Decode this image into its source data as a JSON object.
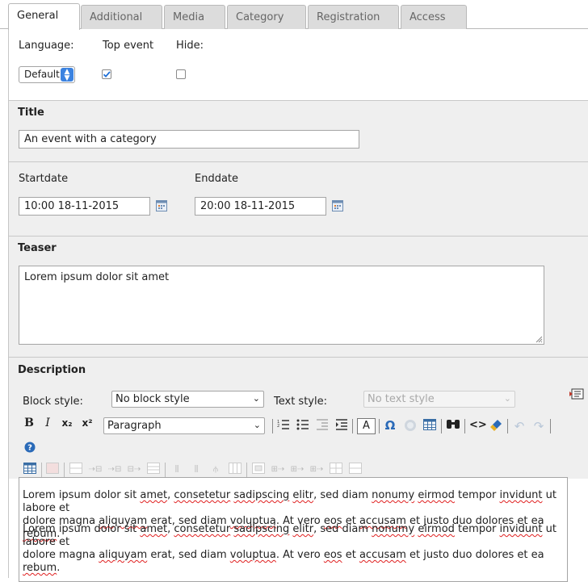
{
  "tabs": [
    {
      "label": "General",
      "active": true
    },
    {
      "label": "Additional",
      "active": false
    },
    {
      "label": "Media",
      "active": false
    },
    {
      "label": "Category",
      "active": false
    },
    {
      "label": "Registration",
      "active": false
    },
    {
      "label": "Access",
      "active": false
    }
  ],
  "general": {
    "language_label": "Language:",
    "top_event_label": "Top event",
    "hide_label": "Hide:",
    "language_value": "Default",
    "top_event_checked": true,
    "hide_checked": false
  },
  "title_section": {
    "heading": "Title",
    "value": "An event with a category"
  },
  "dates": {
    "start_label": "Startdate",
    "start_value": "10:00 18-11-2015",
    "end_label": "Enddate",
    "end_value": "20:00 18-11-2015"
  },
  "teaser": {
    "heading": "Teaser",
    "value": "Lorem ipsum dolor sit amet"
  },
  "description": {
    "heading": "Description",
    "block_style_label": "Block style:",
    "block_style_value": "No block style",
    "text_style_label": "Text style:",
    "text_style_placeholder": "No text style",
    "format_value": "Paragraph",
    "toolbar": {
      "bold": "B",
      "italic": "I",
      "subscript": "x₂",
      "superscript": "x²",
      "text_color": "A",
      "special_char": "Ω",
      "find": "⛶",
      "source": "<>"
    },
    "paragraphs": [
      "Lorem ipsum dolor sit amet, consetetur sadipscing elitr, sed diam nonumy eirmod tempor invidunt ut labore et dolore magna aliquyam erat, sed diam voluptua. At vero eos et accusam et justo duo dolores et ea rebum.",
      "Lorem ipsum dolor sit amet, consetetur sadipscing elitr, sed diam nonumy eirmod tempor invidunt ut labore et dolore magna aliquyam erat, sed diam voluptua. At vero eos et accusam et justo duo dolores et ea rebum."
    ],
    "lines": [
      [
        "Lorem ipsum dolor sit ",
        "amet",
        ", ",
        "consetetur",
        " ",
        "sadipscing",
        " ",
        "elitr",
        ", sed diam ",
        "nonumy",
        " ",
        "eirmod",
        " tempor ",
        "invidunt",
        " ut labore et"
      ],
      [
        "dolore magna ",
        "aliquyam",
        " erat, sed diam ",
        "voluptua",
        ". At vero ",
        "eos",
        " et ",
        "accusam",
        " et justo duo dolores et ea ",
        "rebum",
        "."
      ]
    ]
  },
  "colors": {
    "tab_bg": "#dcdcdc",
    "section_bg": "#efefef",
    "border": "#a5a5a5",
    "accent_blue": "#2a6ab8",
    "spell_error": "#e02020"
  }
}
